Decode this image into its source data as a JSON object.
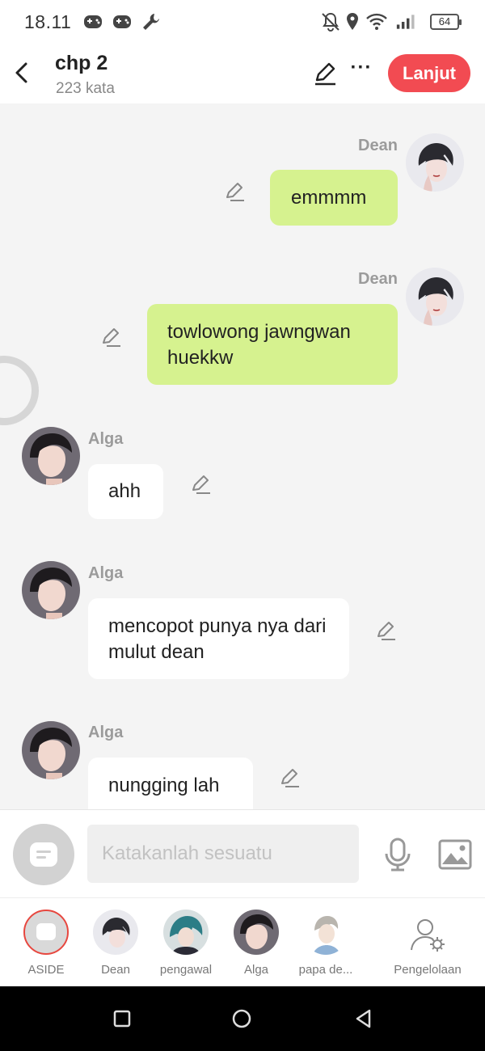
{
  "status_bar": {
    "time": "18.11",
    "battery": "64",
    "left_icons": [
      "gamepad-icon",
      "gamepad-icon",
      "wrench-icon"
    ],
    "right_icons": [
      "bell-muted-icon",
      "location-icon",
      "wifi-icon",
      "signal-icon",
      "battery-icon"
    ]
  },
  "header": {
    "title": "chp 2",
    "word_count": "223 kata",
    "continue_label": "Lanjut",
    "more_label": "···"
  },
  "messages": [
    {
      "sender": "Dean",
      "text": "emmmm",
      "side": "right"
    },
    {
      "sender": "Dean",
      "text": "towlowong jawngwan huekkw",
      "side": "right"
    },
    {
      "sender": "Alga",
      "text": "ahh",
      "side": "left"
    },
    {
      "sender": "Alga",
      "text": "mencopot punya nya dari mulut dean",
      "side": "left"
    },
    {
      "sender": "Alga",
      "text": "nungging lah",
      "side": "left"
    }
  ],
  "input": {
    "placeholder": "Katakanlah sesuatu"
  },
  "characters": [
    {
      "label": "ASIDE"
    },
    {
      "label": "Dean"
    },
    {
      "label": "pengawal"
    },
    {
      "label": "Alga"
    },
    {
      "label": "papa de..."
    },
    {
      "label": "Pengelolaan"
    }
  ],
  "colors": {
    "accent": "#f24b52",
    "right_bubble": "#d6f28f",
    "left_bubble": "#ffffff",
    "background": "#f4f4f4"
  }
}
